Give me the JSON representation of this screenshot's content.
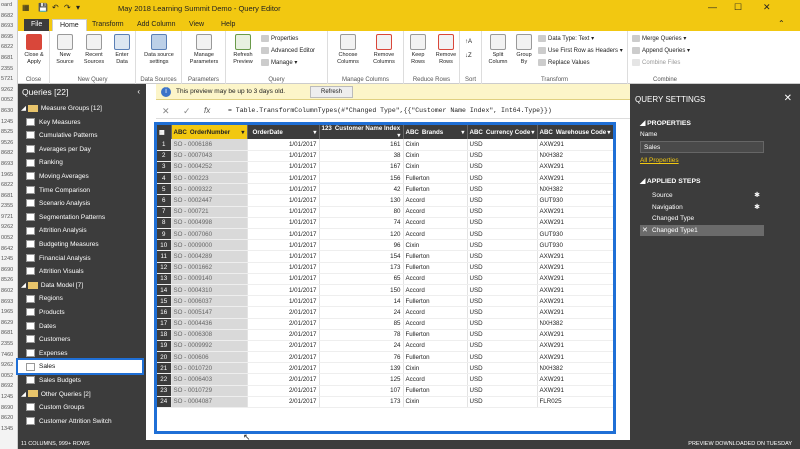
{
  "window": {
    "title": "May 2018 Learning Summit Demo - Query Editor",
    "left_edge_partial": "oard"
  },
  "left_edge_numbers": [
    "8682",
    "8693",
    "8695",
    "6822",
    "8681",
    "2355",
    "5721",
    "9262",
    "0052",
    "8630",
    "1245",
    "8525",
    "9526",
    "8682",
    "8693",
    "1965",
    "6822",
    "8681",
    "2355",
    "9721",
    "9262",
    "0052",
    "8642",
    "1245",
    "8690",
    "8526",
    "8602",
    "8693",
    "1965",
    "8629",
    "8681",
    "2355",
    "7460",
    "9262",
    "0052",
    "8692",
    "1245",
    "8690",
    "8620",
    "1345"
  ],
  "tabs": [
    "File",
    "Home",
    "Transform",
    "Add Column",
    "View",
    "Help"
  ],
  "ribbon": {
    "groups": {
      "close": "Close",
      "new_query": "New Query",
      "data_sources": "Data Sources",
      "parameters": "Parameters",
      "query": "Query",
      "manage_columns": "Manage Columns",
      "reduce_rows": "Reduce Rows",
      "sort": "Sort",
      "transform": "Transform",
      "combine": "Combine"
    },
    "close_apply": "Close & Apply",
    "new_source": "New Source",
    "recent_sources": "Recent Sources",
    "enter_data": "Enter Data",
    "data_source_settings": "Data source settings",
    "manage_parameters": "Manage Parameters",
    "refresh_preview": "Refresh Preview",
    "properties": "Properties",
    "advanced_editor": "Advanced Editor",
    "manage": "Manage",
    "choose_columns": "Choose Columns",
    "remove_columns": "Remove Columns",
    "keep_rows": "Keep Rows",
    "remove_rows": "Remove Rows",
    "split_column": "Split Column",
    "group_by": "Group By",
    "data_type": "Data Type: Text",
    "first_row_headers": "Use First Row as Headers",
    "replace_values": "Replace Values",
    "merge_queries": "Merge Queries",
    "append_queries": "Append Queries",
    "combine_files": "Combine Files"
  },
  "queries": {
    "title": "Queries [22]",
    "items": [
      {
        "type": "folder",
        "label": "Measure Groups [12]"
      },
      {
        "type": "query",
        "label": "Key Measures"
      },
      {
        "type": "query",
        "label": "Cumulative Patterns"
      },
      {
        "type": "query",
        "label": "Averages per Day"
      },
      {
        "type": "query",
        "label": "Ranking"
      },
      {
        "type": "query",
        "label": "Moving Averages"
      },
      {
        "type": "query",
        "label": "Time Comparison"
      },
      {
        "type": "query",
        "label": "Scenario Analysis"
      },
      {
        "type": "query",
        "label": "Segmentation Patterns"
      },
      {
        "type": "query",
        "label": "Attrition Analysis"
      },
      {
        "type": "query",
        "label": "Budgeting Measures"
      },
      {
        "type": "query",
        "label": "Financial Analysis"
      },
      {
        "type": "query",
        "label": "Attrition Visuals"
      },
      {
        "type": "folder",
        "label": "Data Model [7]"
      },
      {
        "type": "query",
        "label": "Regions"
      },
      {
        "type": "query",
        "label": "Products"
      },
      {
        "type": "query",
        "label": "Dates"
      },
      {
        "type": "query",
        "label": "Customers"
      },
      {
        "type": "query",
        "label": "Expenses"
      },
      {
        "type": "query",
        "label": "Sales",
        "selected": true
      },
      {
        "type": "query",
        "label": "Sales Budgets"
      },
      {
        "type": "folder",
        "label": "Other Queries [2]"
      },
      {
        "type": "query",
        "label": "Custom Groups"
      },
      {
        "type": "query",
        "label": "Customer Attrition Switch"
      }
    ]
  },
  "notice": {
    "message": "This preview may be up to 3 days old.",
    "refresh": "Refresh"
  },
  "formula": "= Table.TransformColumnTypes(#\"Changed Type\",{{\"Customer Name Index\", Int64.Type}})",
  "table": {
    "columns": [
      "OrderNumber",
      "OrderDate",
      "Customer Name Index",
      "Brands",
      "Currency Code",
      "Warehouse Code"
    ],
    "column_types": [
      "ABC",
      "",
      "123",
      "ABC",
      "ABC",
      "ABC"
    ],
    "rows": [
      [
        "SO - 0006186",
        "1/01/2017",
        "161",
        "Cixin",
        "USD",
        "AXW291"
      ],
      [
        "SO - 0007043",
        "1/01/2017",
        "38",
        "Cixin",
        "USD",
        "NXH382"
      ],
      [
        "SO - 0004252",
        "1/01/2017",
        "167",
        "Cixin",
        "USD",
        "AXW291"
      ],
      [
        "SO - 000223",
        "1/01/2017",
        "156",
        "Fullerton",
        "USD",
        "AXW291"
      ],
      [
        "SO - 0009322",
        "1/01/2017",
        "42",
        "Fullerton",
        "USD",
        "NXH382"
      ],
      [
        "SO - 0002447",
        "1/01/2017",
        "130",
        "Accord",
        "USD",
        "GUT930"
      ],
      [
        "SO - 000721",
        "1/01/2017",
        "80",
        "Accord",
        "USD",
        "AXW291"
      ],
      [
        "SO - 0004998",
        "1/01/2017",
        "74",
        "Accord",
        "USD",
        "AXW291"
      ],
      [
        "SO - 0007060",
        "1/01/2017",
        "120",
        "Accord",
        "USD",
        "GUT930"
      ],
      [
        "SO - 0009000",
        "1/01/2017",
        "96",
        "Cixin",
        "USD",
        "GUT930"
      ],
      [
        "SO - 0004289",
        "1/01/2017",
        "154",
        "Fullerton",
        "USD",
        "AXW291"
      ],
      [
        "SO - 0001662",
        "1/01/2017",
        "173",
        "Fullerton",
        "USD",
        "AXW291"
      ],
      [
        "SO - 0009140",
        "1/01/2017",
        "65",
        "Accord",
        "USD",
        "AXW291"
      ],
      [
        "SO - 0004310",
        "1/01/2017",
        "150",
        "Accord",
        "USD",
        "AXW291"
      ],
      [
        "SO - 0006037",
        "1/01/2017",
        "14",
        "Fullerton",
        "USD",
        "AXW291"
      ],
      [
        "SO - 0005147",
        "2/01/2017",
        "24",
        "Accord",
        "USD",
        "AXW291"
      ],
      [
        "SO - 0004436",
        "2/01/2017",
        "85",
        "Accord",
        "USD",
        "NXH382"
      ],
      [
        "SO - 0006308",
        "2/01/2017",
        "78",
        "Fullerton",
        "USD",
        "AXW291"
      ],
      [
        "SO - 0009992",
        "2/01/2017",
        "24",
        "Accord",
        "USD",
        "AXW291"
      ],
      [
        "SO - 000606",
        "2/01/2017",
        "76",
        "Fullerton",
        "USD",
        "AXW291"
      ],
      [
        "SO - 0010720",
        "2/01/2017",
        "139",
        "Cixin",
        "USD",
        "NXH382"
      ],
      [
        "SO - 0006403",
        "2/01/2017",
        "125",
        "Accord",
        "USD",
        "AXW291"
      ],
      [
        "SO - 0010729",
        "2/01/2017",
        "107",
        "Fullerton",
        "USD",
        "AXW291"
      ],
      [
        "SO - 0004087",
        "2/01/2017",
        "173",
        "Cixin",
        "USD",
        "FLR025"
      ]
    ]
  },
  "settings": {
    "title": "QUERY SETTINGS",
    "properties": "PROPERTIES",
    "name_label": "Name",
    "name_value": "Sales",
    "all_properties": "All Properties",
    "applied_steps": "APPLIED STEPS",
    "steps": [
      {
        "label": "Source",
        "gear": true
      },
      {
        "label": "Navigation",
        "gear": true
      },
      {
        "label": "Changed Type",
        "gear": false
      },
      {
        "label": "Changed Type1",
        "gear": false,
        "selected": true
      }
    ]
  },
  "status": {
    "left": "11 COLUMNS, 999+ ROWS",
    "right": "PREVIEW DOWNLOADED ON TUESDAY"
  },
  "colors": {
    "accent": "#f2c811",
    "selection": "#1f6fd6",
    "dark": "#3c3c3c"
  }
}
